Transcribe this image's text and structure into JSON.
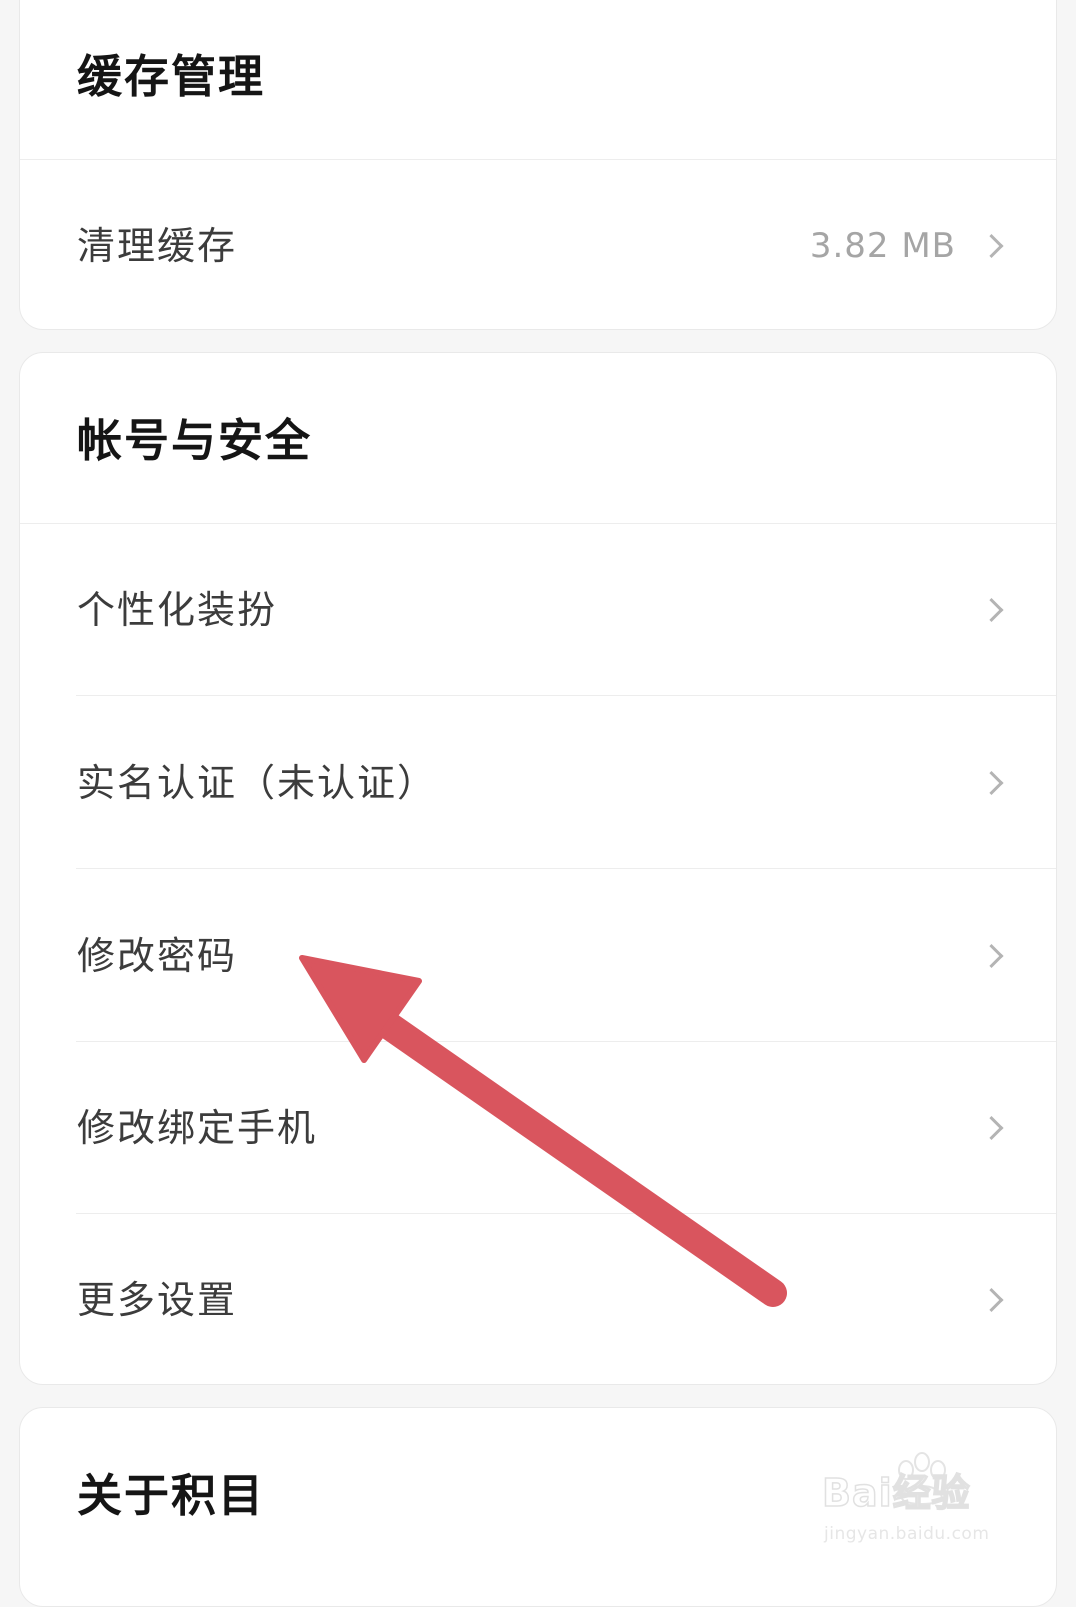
{
  "cache_section": {
    "title": "缓存管理",
    "items": [
      {
        "label": "清理缓存",
        "value": "3.82 MB"
      }
    ]
  },
  "account_section": {
    "title": "帐号与安全",
    "items": [
      {
        "label": "个性化装扮"
      },
      {
        "label": "实名认证（未认证）"
      },
      {
        "label": "修改密码"
      },
      {
        "label": "修改绑定手机"
      },
      {
        "label": "更多设置"
      }
    ]
  },
  "about_section": {
    "title": "关于积目"
  },
  "annotation": {
    "arrow_color": "#d9555e",
    "points_to": "修改密码"
  },
  "watermark": {
    "brand": "Bai经验",
    "url": "jingyan.baidu.com"
  },
  "colors": {
    "background": "#f6f6f6",
    "card": "#ffffff",
    "title_text": "#151515",
    "label_text": "#3c3c3c",
    "secondary_text": "#a5a5a5",
    "chevron": "#b4b4b4"
  }
}
